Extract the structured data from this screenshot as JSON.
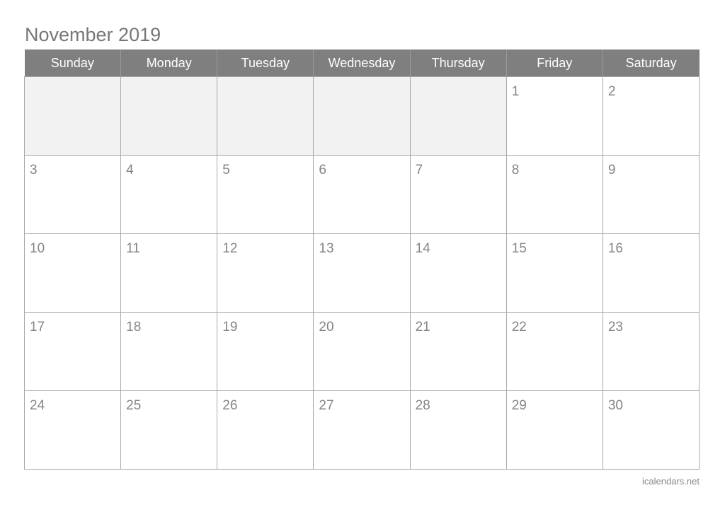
{
  "title": "November 2019",
  "weekdays": [
    "Sunday",
    "Monday",
    "Tuesday",
    "Wednesday",
    "Thursday",
    "Friday",
    "Saturday"
  ],
  "weeks": [
    [
      "",
      "",
      "",
      "",
      "",
      "1",
      "2"
    ],
    [
      "3",
      "4",
      "5",
      "6",
      "7",
      "8",
      "9"
    ],
    [
      "10",
      "11",
      "12",
      "13",
      "14",
      "15",
      "16"
    ],
    [
      "17",
      "18",
      "19",
      "20",
      "21",
      "22",
      "23"
    ],
    [
      "24",
      "25",
      "26",
      "27",
      "28",
      "29",
      "30"
    ]
  ],
  "footer": "icalendars.net",
  "colors": {
    "header_bg": "#7f7f7f",
    "empty_cell": "#f2f2f2",
    "text": "#858585"
  }
}
